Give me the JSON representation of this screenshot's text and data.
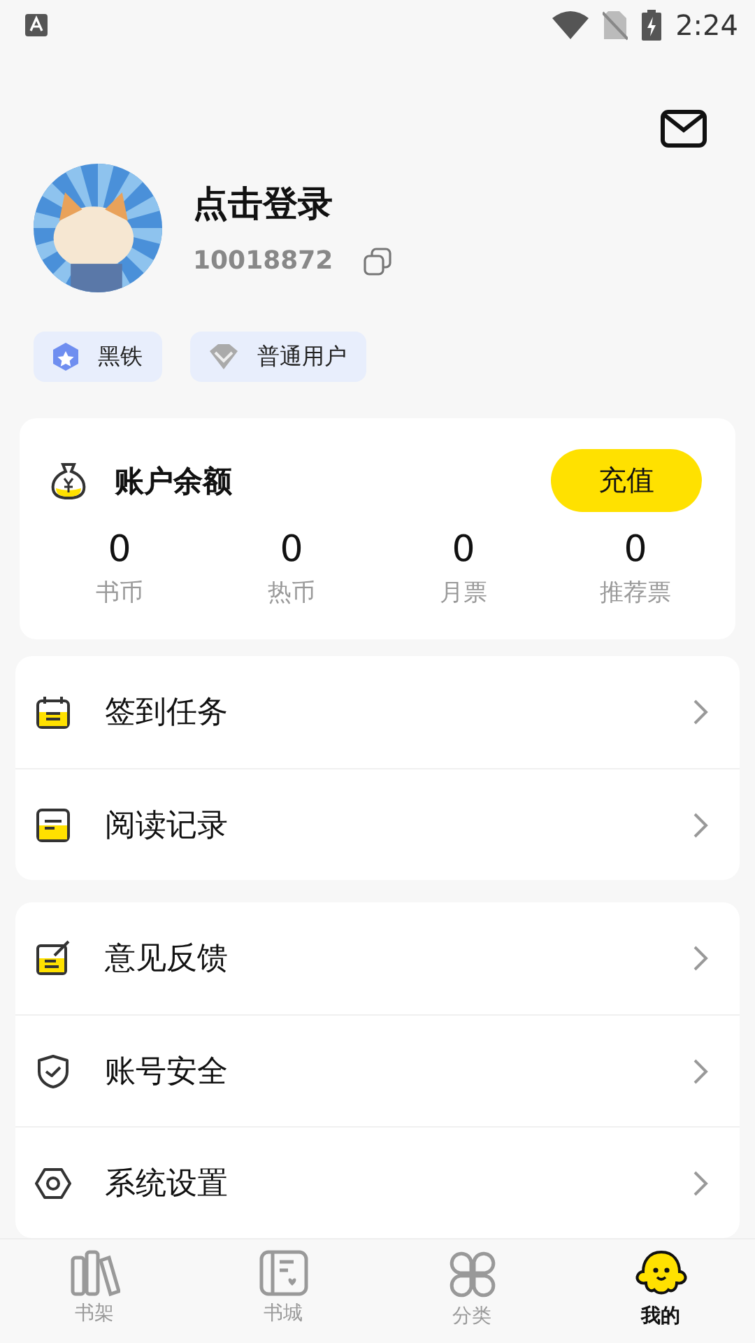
{
  "status_bar": {
    "time": "2:24"
  },
  "profile": {
    "name": "点击登录",
    "user_id": "10018872"
  },
  "badges": [
    {
      "label": "黑铁"
    },
    {
      "label": "普通用户"
    }
  ],
  "balance": {
    "title": "账户余额",
    "button": "充值",
    "stats": [
      {
        "value": "0",
        "label": "书币"
      },
      {
        "value": "0",
        "label": "热币"
      },
      {
        "value": "0",
        "label": "月票"
      },
      {
        "value": "0",
        "label": "推荐票"
      }
    ]
  },
  "menu_groups": [
    {
      "items": [
        {
          "label": "签到任务"
        },
        {
          "label": "阅读记录"
        }
      ]
    },
    {
      "items": [
        {
          "label": "意见反馈"
        },
        {
          "label": "账号安全"
        },
        {
          "label": "系统设置"
        }
      ]
    }
  ],
  "tab_bar": [
    {
      "label": "书架",
      "selected": false
    },
    {
      "label": "书城",
      "selected": false
    },
    {
      "label": "分类",
      "selected": false
    },
    {
      "label": "我的",
      "selected": true
    }
  ]
}
